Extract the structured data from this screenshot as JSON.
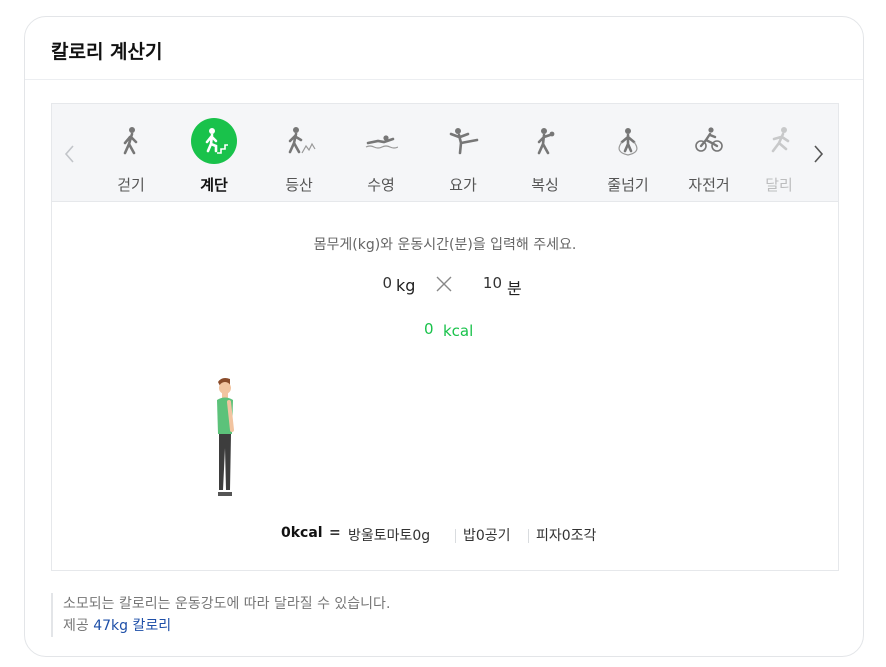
{
  "card": {
    "title": "칼로리 계산기"
  },
  "tabs": [
    {
      "label": "걷기",
      "icon": "walking-icon",
      "active": false
    },
    {
      "label": "계단",
      "icon": "stairs-icon",
      "active": true
    },
    {
      "label": "등산",
      "icon": "hiking-icon",
      "active": false
    },
    {
      "label": "수영",
      "icon": "swimming-icon",
      "active": false
    },
    {
      "label": "요가",
      "icon": "yoga-icon",
      "active": false
    },
    {
      "label": "복싱",
      "icon": "boxing-icon",
      "active": false
    },
    {
      "label": "줄넘기",
      "icon": "jump-rope-icon",
      "active": false
    },
    {
      "label": "자전거",
      "icon": "cycling-icon",
      "active": false
    },
    {
      "label": "달리",
      "icon": "running-icon",
      "active": false
    }
  ],
  "calculator": {
    "instruction": "몸무게(kg)와 운동시간(분)을 입력해 주세요.",
    "weight_value": "0",
    "weight_unit": "kg",
    "time_value": "10",
    "time_unit": "분",
    "result_value": "0",
    "result_unit": "kcal"
  },
  "equivalents": {
    "kcal_label": "0kcal",
    "equals": "=",
    "items": [
      "방울토마토0g",
      "밥0공기",
      "피자0조각"
    ]
  },
  "footer": {
    "note": "소모되는 칼로리는 운동강도에 따라 달라질 수 있습니다.",
    "source_prefix": "제공",
    "source_link": "47kg 칼로리"
  },
  "colors": {
    "accent": "#19c24b",
    "link": "#1e4fa8",
    "tabbar_bg": "#f5f6f8"
  }
}
